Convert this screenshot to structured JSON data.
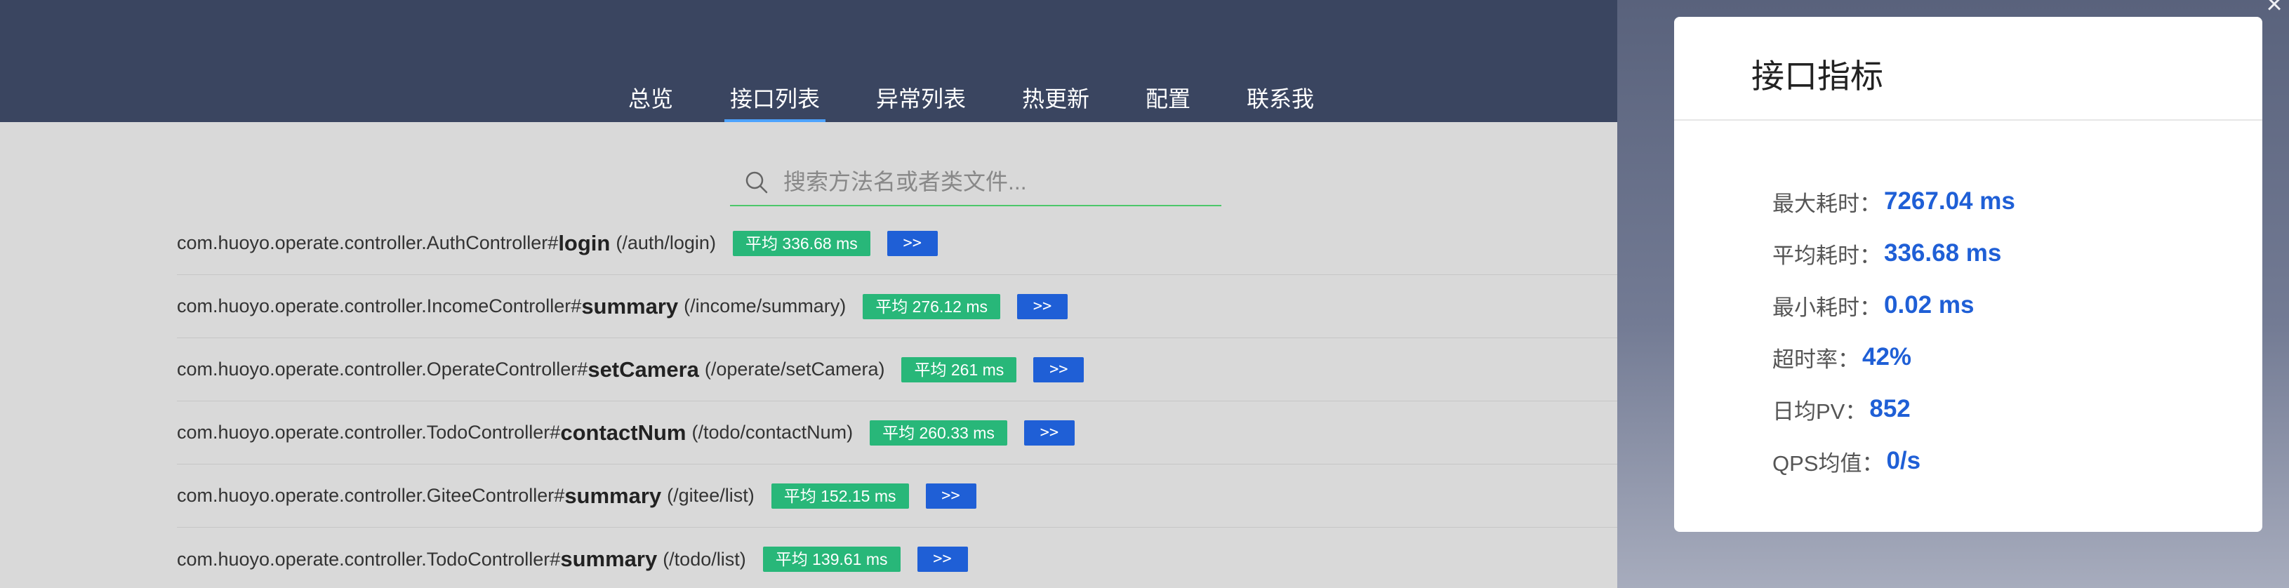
{
  "nav": {
    "items": [
      {
        "label": "总览",
        "active": false
      },
      {
        "label": "接口列表",
        "active": true
      },
      {
        "label": "异常列表",
        "active": false
      },
      {
        "label": "热更新",
        "active": false
      },
      {
        "label": "配置",
        "active": false
      },
      {
        "label": "联系我",
        "active": false
      }
    ]
  },
  "search": {
    "placeholder": "搜索方法名或者类文件...",
    "value": "",
    "icon": "search-icon"
  },
  "rows": [
    {
      "cls": "com.huoyo.operate.controller.AuthController#",
      "method": "login",
      "path": "(/auth/login)",
      "avg": "平均 336.68 ms",
      "btn": ">>"
    },
    {
      "cls": "com.huoyo.operate.controller.IncomeController#",
      "method": "summary",
      "path": "(/income/summary)",
      "avg": "平均 276.12 ms",
      "btn": ">>"
    },
    {
      "cls": "com.huoyo.operate.controller.OperateController#",
      "method": "setCamera",
      "path": "(/operate/setCamera)",
      "avg": "平均 261 ms",
      "btn": ">>"
    },
    {
      "cls": "com.huoyo.operate.controller.TodoController#",
      "method": "contactNum",
      "path": "(/todo/contactNum)",
      "avg": "平均 260.33 ms",
      "btn": ">>"
    },
    {
      "cls": "com.huoyo.operate.controller.GiteeController#",
      "method": "summary",
      "path": "(/gitee/list)",
      "avg": "平均 152.15 ms",
      "btn": ">>"
    },
    {
      "cls": "com.huoyo.operate.controller.TodoController#",
      "method": "summary",
      "path": "(/todo/list)",
      "avg": "平均 139.61 ms",
      "btn": ">>"
    }
  ],
  "panel": {
    "title": "接口指标",
    "close_icon": "close-icon",
    "metrics": [
      {
        "label": "最大耗时：",
        "value": "7267.04 ms"
      },
      {
        "label": "平均耗时：",
        "value": "336.68 ms"
      },
      {
        "label": "最小耗时：",
        "value": "0.02 ms"
      },
      {
        "label": "超时率：",
        "value": "42%"
      },
      {
        "label": "日均PV：",
        "value": "852"
      },
      {
        "label": "QPS均值：",
        "value": "0/s"
      }
    ]
  },
  "colors": {
    "header": "#3a4560",
    "avg_badge": "#28b779",
    "go_button": "#1f5fd6",
    "metric_value": "#1f5fd6",
    "search_underline": "#4cc76a"
  }
}
